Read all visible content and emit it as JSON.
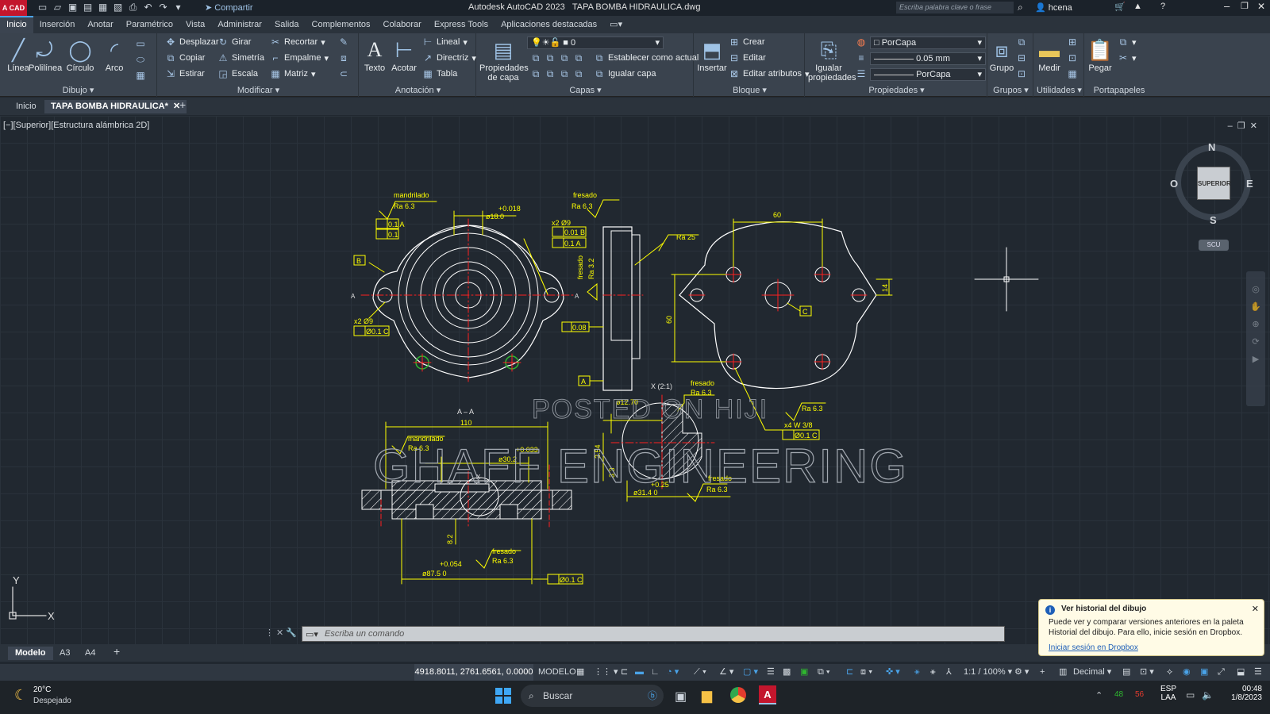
{
  "app": {
    "title": "Autodesk AutoCAD 2023",
    "file": "TAPA BOMBA HIDRAULICA.dwg",
    "share": "Compartir",
    "search_placeholder": "Escriba palabra clave o frase",
    "user": "hcena",
    "logo": "A CAD"
  },
  "ribbon_tabs": [
    "Inicio",
    "Inserción",
    "Anotar",
    "Paramétrico",
    "Vista",
    "Administrar",
    "Salida",
    "Complementos",
    "Colaborar",
    "Express Tools",
    "Aplicaciones destacadas"
  ],
  "ribbon": {
    "dibujo": {
      "title": "Dibujo",
      "linea": "Línea",
      "polilinea": "Polilínea",
      "circulo": "Círculo",
      "arco": "Arco"
    },
    "modificar": {
      "title": "Modificar",
      "desplazar": "Desplazar",
      "girar": "Girar",
      "recortar": "Recortar",
      "copiar": "Copiar",
      "simetria": "Simetría",
      "empalme": "Empalme",
      "estirar": "Estirar",
      "escala": "Escala",
      "matriz": "Matriz"
    },
    "anotacion": {
      "title": "Anotación",
      "texto": "Texto",
      "acotar": "Acotar",
      "lineal": "Lineal",
      "directriz": "Directriz",
      "tabla": "Tabla"
    },
    "capas": {
      "title": "Capas",
      "propiedades": "Propiedades",
      "de_capa": "de capa",
      "layer_value": "0",
      "establecer": "Establecer como actual",
      "igualar": "Igualar capa"
    },
    "bloque": {
      "title": "Bloque",
      "insertar": "Insertar",
      "crear": "Crear",
      "editar": "Editar",
      "editar_atributos": "Editar atributos"
    },
    "propiedades": {
      "title": "Propiedades",
      "igualar": "Igualar",
      "propiedades": "propiedades",
      "color": "PorCapa",
      "lineweight": "0.05 mm",
      "linetype": "PorCapa"
    },
    "grupos": {
      "title": "Grupos",
      "grupo": "Grupo"
    },
    "utilidades": {
      "title": "Utilidades",
      "medir": "Medir"
    },
    "portapapeles": {
      "title": "Portapapeles",
      "pegar": "Pegar"
    }
  },
  "doc_tabs": {
    "home": "Inicio",
    "active": "TAPA BOMBA HIDRAULICA*"
  },
  "viewport_label": "[−][Superior][Estructura alámbrica 2D]",
  "viewcube": {
    "n": "N",
    "s": "S",
    "e": "E",
    "o": "O",
    "face": "SUPERIOR",
    "ucs": "SCU"
  },
  "ucs_icon": {
    "x": "X",
    "y": "Y"
  },
  "drawing": {
    "section_label": "A – A",
    "detail_label": "X (2:1)",
    "watermark1": "POSTED ON HIJI",
    "watermark2": "GHAFF ENGINEERING",
    "labels": {
      "mandrilado": "mandrilado",
      "fresado": "fresado",
      "ra63": "Ra 6.3",
      "ra25": "Ra 25",
      "ra32": "Ra 3.2",
      "d18": "ø18.0",
      "tol018": "+0.018",
      "x2d9": "x2 Ø9",
      "tol01a": "0.1 A",
      "tol01": "0.1",
      "tol01b": "0.01 B",
      "tol01a2": "0.1 A",
      "x2d9b": "x2 Ø9",
      "pos01c": "Ø0.1 C",
      "d008": "0.08",
      "a": "A",
      "b": "B",
      "c": "C",
      "dim60": "60",
      "dim60v": "60",
      "dim14": "14",
      "x4w38": "x4 W 3/8",
      "pos01c2": "Ø0.1 C",
      "dim110": "110",
      "d302": "ø30.2",
      "tol033": "+0.033",
      "dim82": "8.2",
      "d875": "ø87.5 0",
      "tol054": "+0.054",
      "pos01c3": "Ø0.1 C",
      "d127": "ø12.70",
      "dim254": "2.54",
      "dim33": "3.3",
      "d314": "ø31.4 0",
      "tol025": "+0.25",
      "x": "X"
    }
  },
  "command_placeholder": "Escriba un comando",
  "layout_tabs": [
    "Modelo",
    "A3",
    "A4"
  ],
  "status": {
    "coords": "4918.8011, 2761.6561, 0.0000",
    "space": "MODELO",
    "scale": "1:1 / 100%",
    "units": "Decimal"
  },
  "notification": {
    "title": "Ver historial del dibujo",
    "body": "Puede ver y comparar versiones anteriores en la paleta Historial del dibujo. Para ello, inicie sesión en Dropbox.",
    "link": "Iniciar sesión en Dropbox"
  },
  "taskbar": {
    "weather_temp": "20°C",
    "weather_desc": "Despejado",
    "search": "Buscar",
    "lang1": "ESP",
    "lang2": "LAA",
    "time": "00:48",
    "date": "1/8/2023"
  },
  "colors": {
    "accent": "#4aa3e8",
    "draft_yellow": "#ffff00",
    "center_red": "#ff2020",
    "green": "#2fb82f",
    "autocad_red": "#c3162d"
  }
}
